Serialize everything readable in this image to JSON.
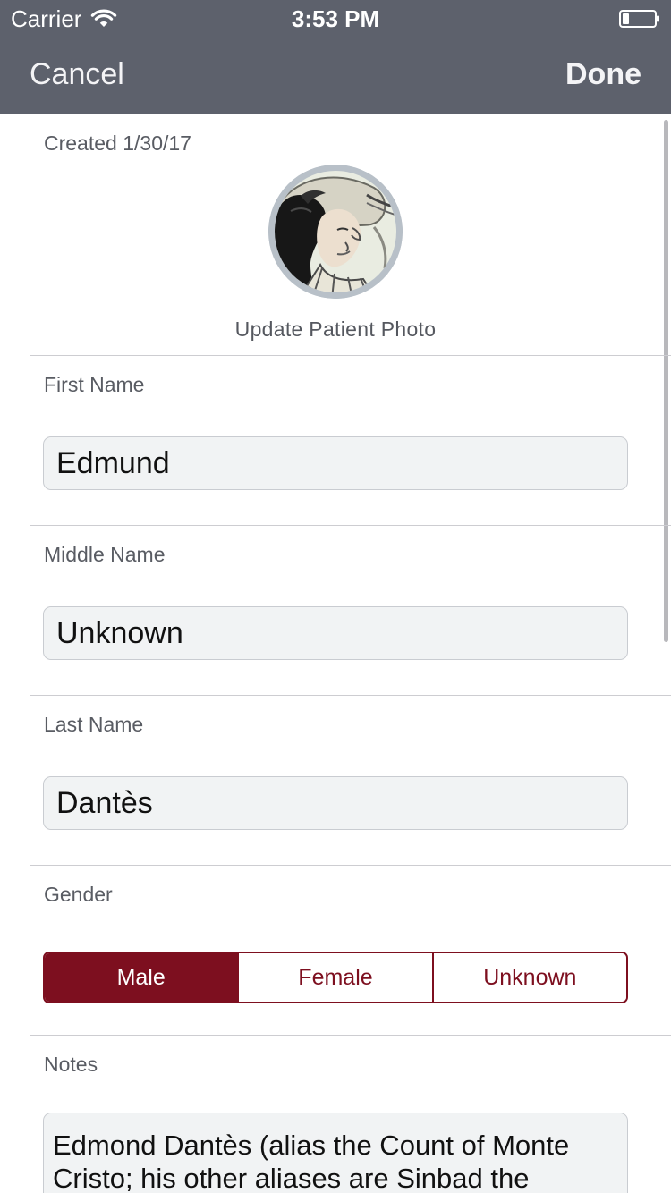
{
  "status_bar": {
    "carrier": "Carrier",
    "time": "3:53 PM",
    "icons": [
      "wifi-icon",
      "battery-icon"
    ]
  },
  "nav": {
    "cancel_label": "Cancel",
    "done_label": "Done",
    "background_color": "#5d616c"
  },
  "patient": {
    "created": "Created 1/30/17",
    "update_photo_label": "Update Patient Photo"
  },
  "fields": {
    "first_name": {
      "label": "First Name",
      "value": "Edmund"
    },
    "middle_name": {
      "label": "Middle Name",
      "value": "Unknown"
    },
    "last_name": {
      "label": "Last Name",
      "value": "Dantès"
    }
  },
  "gender": {
    "label": "Gender",
    "options": [
      "Male",
      "Female",
      "Unknown"
    ],
    "selected": "Male",
    "accent_color": "#7d0f1f"
  },
  "notes": {
    "label": "Notes",
    "value": "Edmond Dantès (alias the Count of Monte Cristo; his other aliases are Sinbad the"
  }
}
